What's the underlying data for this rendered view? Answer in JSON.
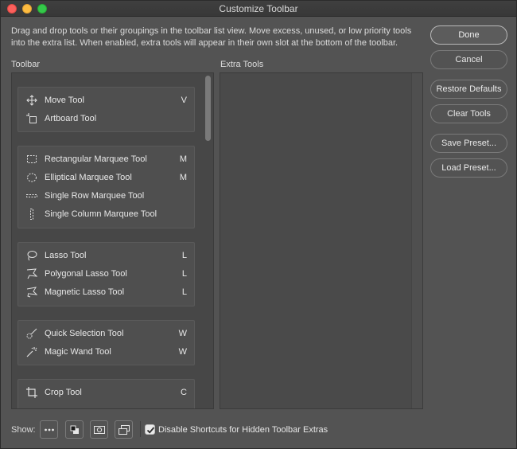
{
  "window": {
    "title": "Customize Toolbar"
  },
  "description": "Drag and drop tools or their groupings in the toolbar list view. Move excess, unused, or low priority tools into the extra list. When enabled, extra tools will appear in their own slot at the bottom of the toolbar.",
  "sections": {
    "toolbar_label": "Toolbar",
    "extra_label": "Extra Tools"
  },
  "tool_groups": [
    {
      "tools": [
        {
          "name": "Move Tool",
          "key": "V",
          "icon": "move-icon"
        },
        {
          "name": "Artboard Tool",
          "key": "",
          "icon": "artboard-icon"
        }
      ]
    },
    {
      "tools": [
        {
          "name": "Rectangular Marquee Tool",
          "key": "M",
          "icon": "rect-marquee-icon"
        },
        {
          "name": "Elliptical Marquee Tool",
          "key": "M",
          "icon": "ellipse-marquee-icon"
        },
        {
          "name": "Single Row Marquee Tool",
          "key": "",
          "icon": "row-marquee-icon"
        },
        {
          "name": "Single Column Marquee Tool",
          "key": "",
          "icon": "column-marquee-icon"
        }
      ]
    },
    {
      "tools": [
        {
          "name": "Lasso Tool",
          "key": "L",
          "icon": "lasso-icon"
        },
        {
          "name": "Polygonal Lasso Tool",
          "key": "L",
          "icon": "polygonal-lasso-icon"
        },
        {
          "name": "Magnetic Lasso Tool",
          "key": "L",
          "icon": "magnetic-lasso-icon"
        }
      ]
    },
    {
      "tools": [
        {
          "name": "Quick Selection Tool",
          "key": "W",
          "icon": "quick-selection-icon"
        },
        {
          "name": "Magic Wand Tool",
          "key": "W",
          "icon": "magic-wand-icon"
        }
      ]
    },
    {
      "tools": [
        {
          "name": "Crop Tool",
          "key": "C",
          "icon": "crop-icon"
        }
      ]
    }
  ],
  "buttons": {
    "done": "Done",
    "cancel": "Cancel",
    "restore_defaults": "Restore Defaults",
    "clear_tools": "Clear Tools",
    "save_preset": "Save Preset...",
    "load_preset": "Load Preset..."
  },
  "bottom": {
    "show_label": "Show:",
    "show_buttons": [
      "more-icon",
      "foreground-background-icon",
      "quick-mask-icon",
      "screen-mode-icon"
    ],
    "checkbox_label": "Disable Shortcuts for Hidden Toolbar Extras",
    "checkbox_checked": true
  }
}
